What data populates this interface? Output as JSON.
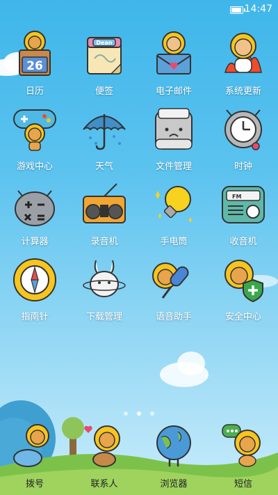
{
  "status": {
    "time": "14:47",
    "battery_level": 0.8
  },
  "apps": [
    {
      "id": "calendar",
      "label": "日历",
      "icon": "calendar-icon",
      "day": "26"
    },
    {
      "id": "notes",
      "label": "便签",
      "icon": "notes-icon",
      "tag": "Dean"
    },
    {
      "id": "email",
      "label": "电子邮件",
      "icon": "email-icon"
    },
    {
      "id": "system-update",
      "label": "系统更新",
      "icon": "system-update-icon"
    },
    {
      "id": "game-center",
      "label": "游戏中心",
      "icon": "gamepad-icon"
    },
    {
      "id": "weather",
      "label": "天气",
      "icon": "umbrella-icon"
    },
    {
      "id": "file-manager",
      "label": "文件管理",
      "icon": "folder-icon"
    },
    {
      "id": "clock",
      "label": "时钟",
      "icon": "clock-icon"
    },
    {
      "id": "calculator",
      "label": "计算器",
      "icon": "calculator-icon"
    },
    {
      "id": "recorder",
      "label": "录音机",
      "icon": "boombox-icon"
    },
    {
      "id": "flashlight",
      "label": "手电筒",
      "icon": "lightbulb-icon"
    },
    {
      "id": "radio",
      "label": "收音机",
      "icon": "radio-icon",
      "band": "FM"
    },
    {
      "id": "compass",
      "label": "指南针",
      "icon": "compass-icon"
    },
    {
      "id": "download-manager",
      "label": "下载管理",
      "icon": "download-bunny-icon"
    },
    {
      "id": "voice-assistant",
      "label": "语音助手",
      "icon": "microphone-icon"
    },
    {
      "id": "security-center",
      "label": "安全中心",
      "icon": "shield-icon"
    }
  ],
  "page_indicator": {
    "pages": 3,
    "current": 2
  },
  "dock": [
    {
      "id": "phone",
      "label": "拨号",
      "icon": "phone-icon"
    },
    {
      "id": "contacts",
      "label": "联系人",
      "icon": "contacts-icon"
    },
    {
      "id": "browser",
      "label": "浏览器",
      "icon": "globe-icon"
    },
    {
      "id": "messages",
      "label": "短信",
      "icon": "message-icon"
    }
  ],
  "colors": {
    "sky_top": "#3fb6ea",
    "sky_bottom": "#c9ecfb",
    "grass": "#7cc24a",
    "sunflower_petal": "#f7c51e",
    "bear": "#e8a54b"
  }
}
